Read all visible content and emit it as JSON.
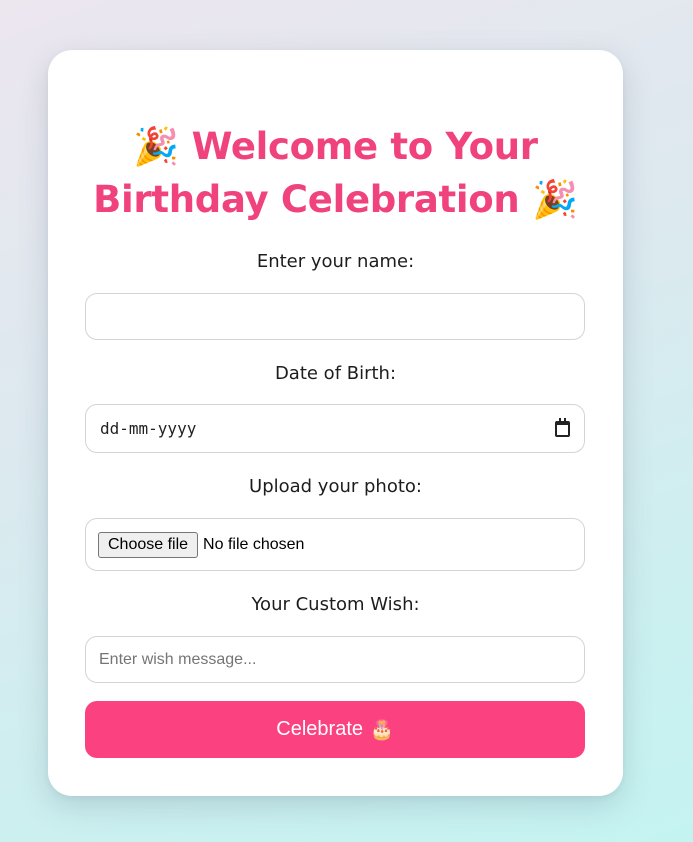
{
  "colors": {
    "accent": "#f0427d",
    "button": "#fb4180",
    "card": "#ffffff",
    "border": "#d4d4d4"
  },
  "title": {
    "line1": "Welcome to Your",
    "line2": "Birthday Celebration",
    "emoji_left": "🎉",
    "emoji_right": "🎉",
    "icon": "party-popper-icon"
  },
  "form": {
    "name_label": "Enter your name:",
    "name_value": "",
    "dob_label": "Date of Birth:",
    "dob_placeholder": "dd-mm-yyyy",
    "photo_label": "Upload your photo:",
    "file_button": "Choose file",
    "file_status": "No file chosen",
    "wish_label": "Your Custom Wish:",
    "wish_placeholder": "Enter wish message...",
    "submit_label": "Celebrate",
    "submit_emoji": "🎂"
  }
}
